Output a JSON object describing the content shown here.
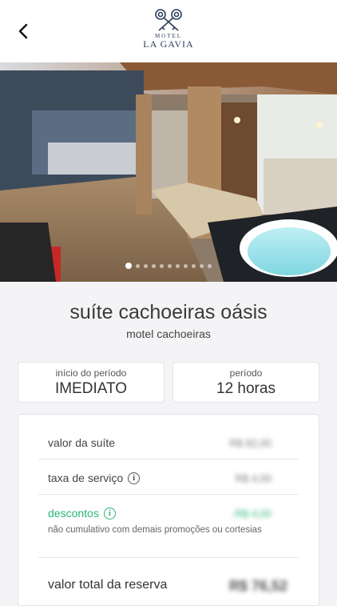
{
  "header": {
    "back_icon": "chevron-left-icon",
    "logo_icon": "crossed-keys-icon",
    "logo_top": "MOTEL",
    "logo_name": "LA GAVIA"
  },
  "gallery": {
    "dot_count": 11,
    "active_index": 0
  },
  "suite": {
    "name": "suíte cachoeiras oásis",
    "motel": "motel cachoeiras"
  },
  "period_start": {
    "label": "início do período",
    "value": "IMEDIATO"
  },
  "period_length": {
    "label": "período",
    "value": "12 horas"
  },
  "pricing": {
    "suite_value_label": "valor da suíte",
    "suite_value": "R$ 82,00",
    "service_fee_label": "taxa de serviço",
    "service_fee": "R$ 4,00",
    "discounts_label": "descontos",
    "discounts_value": "-R$ 4,00",
    "discounts_note": "não cumulativo com demais promoções ou cortesias",
    "total_label": "valor total da reserva",
    "total_value": "R$ 76,52",
    "discount_color": "#2bb673"
  }
}
